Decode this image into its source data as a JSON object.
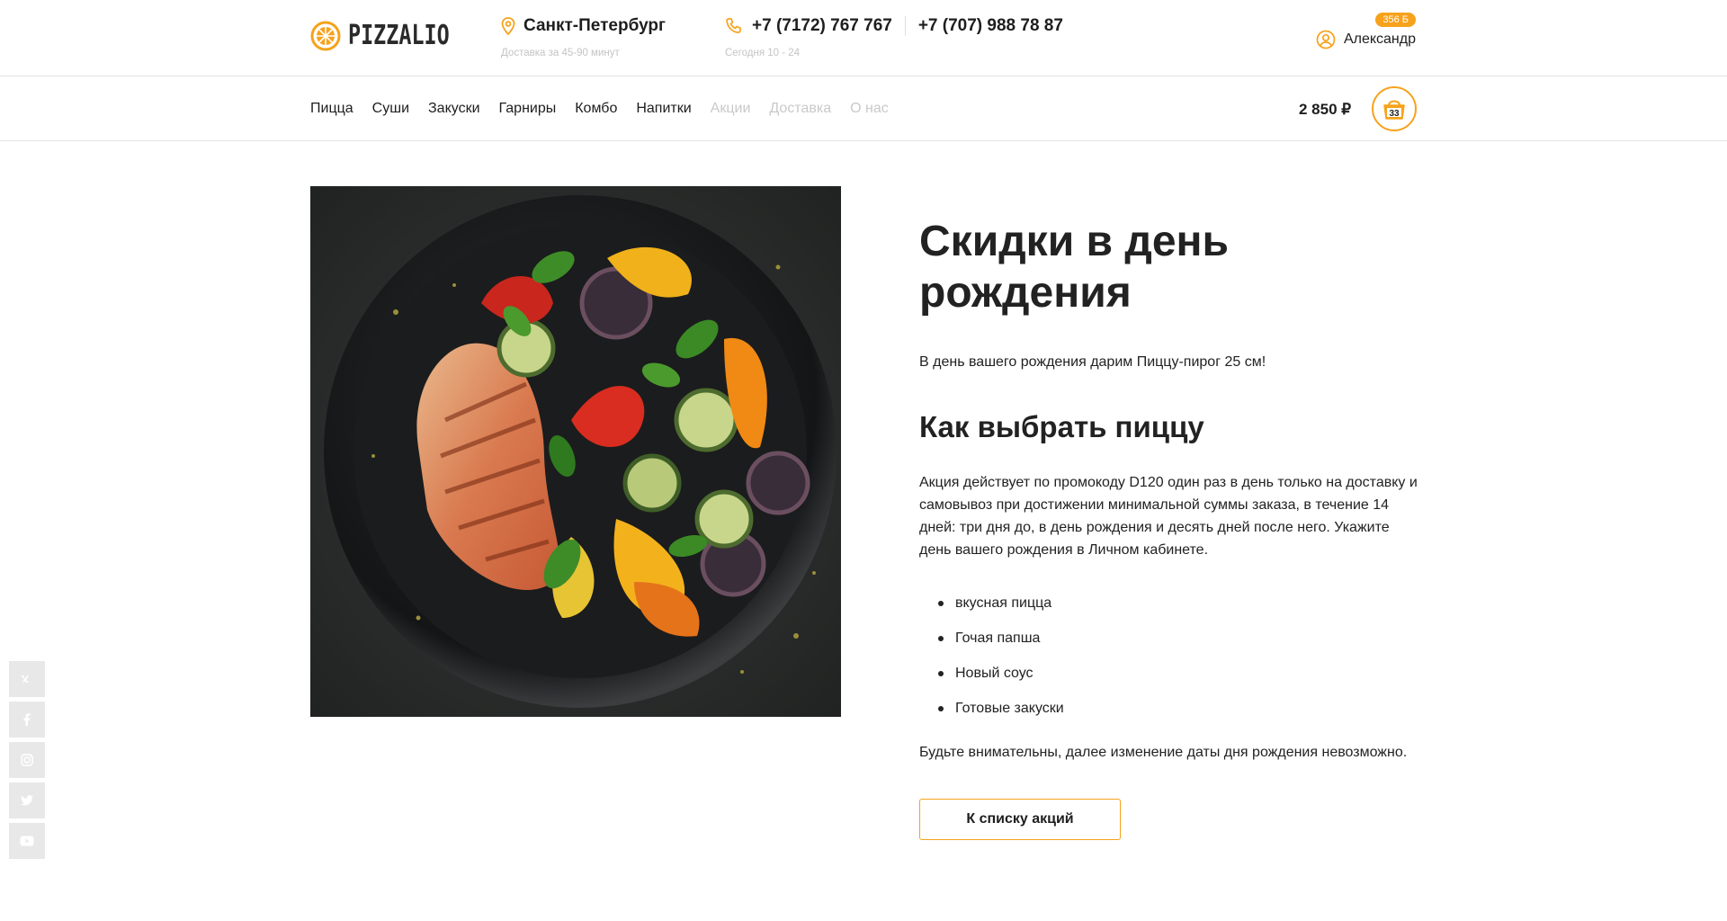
{
  "brand": {
    "name": "PIZZALIO",
    "accent": "#f7a21b"
  },
  "location": {
    "city": "Санкт-Петербург",
    "delivery_note": "Доставка за 45-90 минут"
  },
  "contacts": {
    "phone1": "+7 (7172) 767 767",
    "phone2": "+7 (707) 988 78 87",
    "hours": "Сегодня 10 - 24"
  },
  "user": {
    "name": "Александр",
    "bonus": "356 Б"
  },
  "nav": {
    "items": [
      {
        "label": "Пицца",
        "muted": false
      },
      {
        "label": "Суши",
        "muted": false
      },
      {
        "label": "Закуски",
        "muted": false
      },
      {
        "label": "Гарниры",
        "muted": false
      },
      {
        "label": "Комбо",
        "muted": false
      },
      {
        "label": "Напитки",
        "muted": false
      },
      {
        "label": "Акции",
        "muted": true
      },
      {
        "label": "Доставка",
        "muted": true
      },
      {
        "label": "О нас",
        "muted": true
      }
    ]
  },
  "cart": {
    "total": "2 850 ₽",
    "count": "33"
  },
  "article": {
    "title": "Скидки в день рождения",
    "intro": "В день вашего рождения дарим Пиццу-пирог 25 см!",
    "subtitle": "Как выбрать пиццу",
    "body": "Акция действует по промокоду D120 один раз в день только на доставку и самовывоз при достижении минимальной суммы заказа, в течение 14 дней: три дня до, в день рождения и десять дней после него. Укажите день вашего рождения в Личном кабинете.",
    "features": [
      "вкусная пицца",
      "Гочая папша",
      "Новый соус",
      "Готовые закуски"
    ],
    "note": "Будьте внимательны, далее изменение даты дня рождения невозможно.",
    "back_button": "К списку акций"
  },
  "social": {
    "icons": [
      "vk-icon",
      "facebook-icon",
      "instagram-icon",
      "twitter-icon",
      "youtube-icon"
    ]
  }
}
